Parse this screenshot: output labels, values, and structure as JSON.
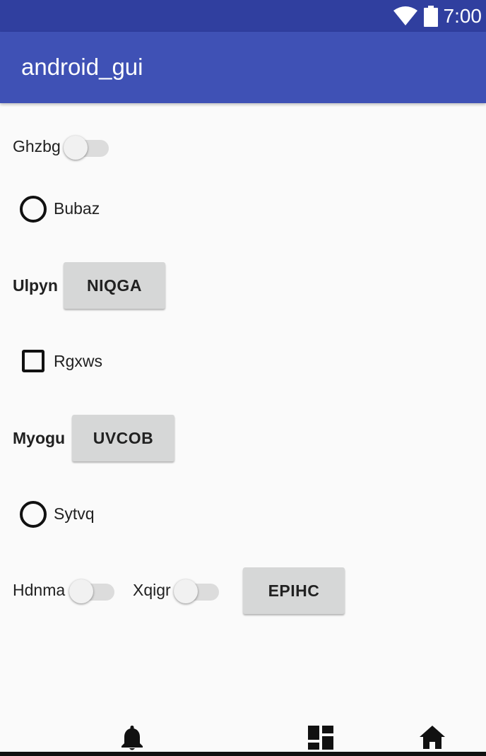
{
  "status_bar": {
    "time": "7:00",
    "icons": [
      "wifi-icon",
      "battery-icon"
    ],
    "color": "#303f9f"
  },
  "app_bar": {
    "title": "android_gui",
    "color": "#3f51b5"
  },
  "rows": {
    "ghzbg": {
      "label": "Ghzbg",
      "switch_on": false
    },
    "bubaz": {
      "label": "Bubaz",
      "checked": false
    },
    "ulpyn": {
      "label": "Ulpyn",
      "button": "NIQGA"
    },
    "rgxws": {
      "label": "Rgxws",
      "checked": false
    },
    "myogu": {
      "label": "Myogu",
      "button": "UVCOB"
    },
    "sytvq": {
      "label": "Sytvq",
      "checked": false
    },
    "hdnma": {
      "label": "Hdnma",
      "switch_on": false
    },
    "xqigr": {
      "label": "Xqigr",
      "switch_on": false
    },
    "epihc": {
      "button": "EPIHC"
    }
  },
  "bottom_nav": {
    "icons": [
      "bell-icon",
      "dashboard-icon",
      "home-icon"
    ]
  }
}
